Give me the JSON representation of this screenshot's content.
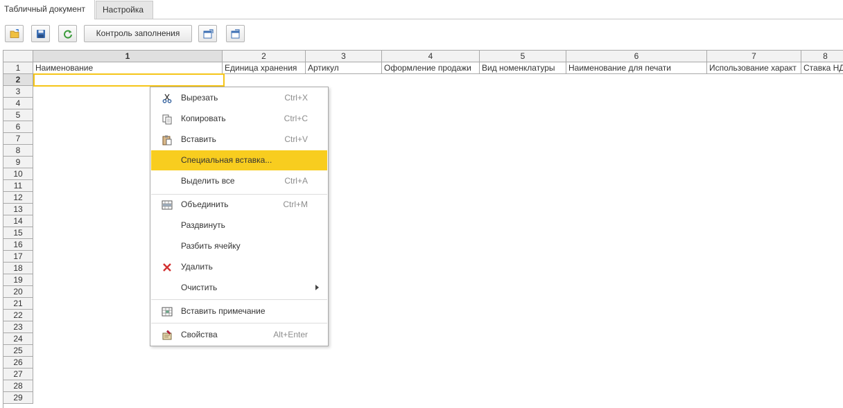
{
  "tabs": [
    {
      "label": "Табличный документ",
      "active": true
    },
    {
      "label": "Настройка",
      "active": false
    }
  ],
  "toolbar": {
    "open_icon": "folder-open-icon",
    "save_icon": "save-icon",
    "refresh_icon": "refresh-icon",
    "fill_control_label": "Контроль заполнения",
    "export_icon": "export-icon",
    "import_icon": "import-icon",
    "refresh_color": "#3a9a3a"
  },
  "sheet": {
    "columns": [
      "1",
      "2",
      "3",
      "4",
      "5",
      "6",
      "7",
      "8"
    ],
    "selected_column": "1",
    "header_row": [
      "Наименование",
      "Единица хранения",
      "Артикул",
      "Оформление продажи",
      "Вид номенклатуры",
      "Наименование для печати",
      "Использование характ",
      "Ставка НДС"
    ],
    "rows": [
      "1",
      "2",
      "3",
      "4",
      "5",
      "6",
      "7",
      "8",
      "9",
      "10",
      "11",
      "12",
      "13",
      "14",
      "15",
      "16",
      "17",
      "18",
      "19",
      "20",
      "21",
      "22",
      "23",
      "24",
      "25",
      "26",
      "27",
      "28",
      "29"
    ],
    "selected_row": "2",
    "selection_color": "#f5c518"
  },
  "context_menu": {
    "highlight_color": "#f8cd1f",
    "items": [
      {
        "label": "Вырезать",
        "shortcut": "Ctrl+X",
        "icon": "scissors-icon"
      },
      {
        "label": "Копировать",
        "shortcut": "Ctrl+C",
        "icon": "copy-icon"
      },
      {
        "label": "Вставить",
        "shortcut": "Ctrl+V",
        "icon": "paste-icon"
      },
      {
        "label": "Специальная вставка...",
        "shortcut": "",
        "icon": "",
        "highlighted": true
      },
      {
        "label": "Выделить все",
        "shortcut": "Ctrl+A",
        "icon": ""
      },
      {
        "label": "Объединить",
        "shortcut": "Ctrl+M",
        "icon": "merge-cells-icon"
      },
      {
        "label": "Раздвинуть",
        "shortcut": "",
        "icon": ""
      },
      {
        "label": "Разбить ячейку",
        "shortcut": "",
        "icon": ""
      },
      {
        "label": "Удалить",
        "shortcut": "",
        "icon": "delete-icon"
      },
      {
        "label": "Очистить",
        "shortcut": "",
        "icon": "",
        "submenu": true
      },
      {
        "label": "Вставить примечание",
        "shortcut": "",
        "icon": "note-icon"
      },
      {
        "label": "Свойства",
        "shortcut": "Alt+Enter",
        "icon": "properties-icon"
      }
    ]
  }
}
